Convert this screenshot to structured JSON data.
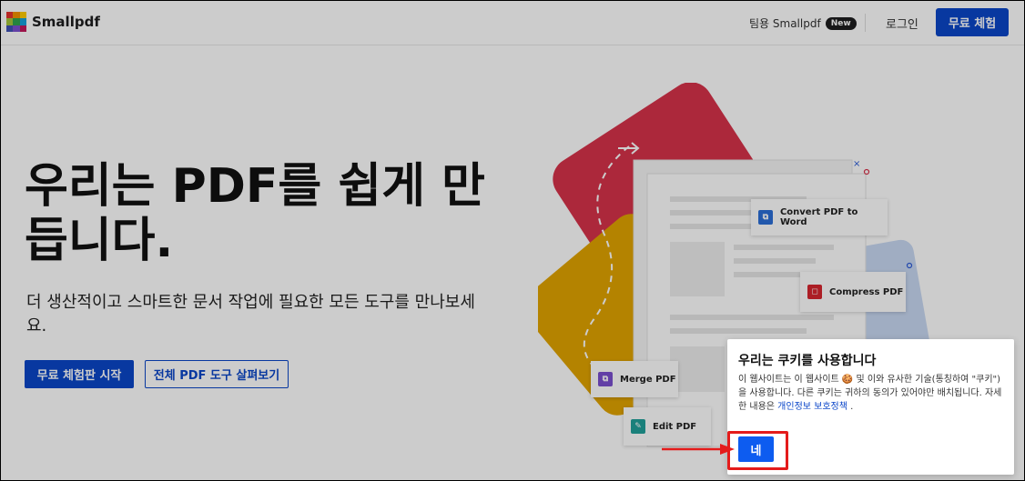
{
  "header": {
    "logo_text": "Smallpdf",
    "team_label": "팀용 Smallpdf",
    "new_badge": "New",
    "login": "로그인",
    "free_trial": "무료 체험"
  },
  "hero": {
    "title": "우리는 PDF를 쉽게 만듭니다.",
    "subtitle": "더 생산적이고 스마트한 문서 작업에 필요한 모든 도구를 만나보세요.",
    "primary_button": "무료 체험판 시작",
    "secondary_button": "전체 PDF 도구 살펴보기"
  },
  "tool_cards": [
    {
      "label": "Convert PDF to Word",
      "icon": "word-icon",
      "color": "#2b6ed8"
    },
    {
      "label": "Compress PDF",
      "icon": "compress-icon",
      "color": "#d8262f"
    },
    {
      "label": "Merge PDF",
      "icon": "merge-icon",
      "color": "#7b4fd0"
    },
    {
      "label": "Edit PDF",
      "icon": "edit-icon",
      "color": "#21a19a"
    }
  ],
  "cookie": {
    "title": "우리는 쿠키를 사용합니다",
    "text_part1": "이 웹사이트는 이 웹사이트 🍪 및 이와 유사한 기술(통칭하여 \"쿠키\")을 사용합니다. 다른 쿠키는 귀하의 동의가 있어야만 배치됩니다. 자세한 내용은 ",
    "link": "개인정보 보호정책",
    "text_part2": " .",
    "accept": "네"
  },
  "colors": {
    "brand_blue": "#0b46c9",
    "accept_blue": "#0d5cf0",
    "highlight_red": "#e41b1b",
    "illus_red": "#d8324a",
    "illus_yellow": "#e2a400",
    "illus_lightblue": "#c9d9f3"
  }
}
